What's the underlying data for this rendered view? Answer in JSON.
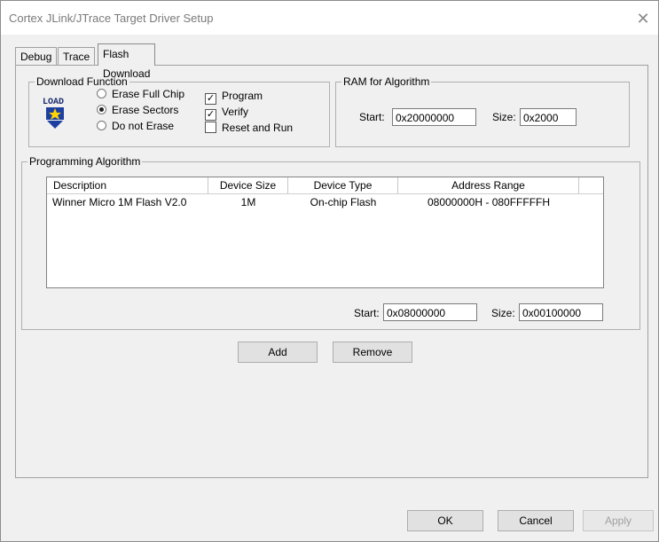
{
  "window": {
    "title": "Cortex JLink/JTrace Target Driver Setup",
    "close_glyph": "✕"
  },
  "tabs": [
    {
      "label": "Debug"
    },
    {
      "label": "Trace"
    },
    {
      "label": "Flash Download"
    }
  ],
  "download_function": {
    "label": "Download Function",
    "icon_text": "LOAD",
    "erase_full_chip": "Erase Full Chip",
    "erase_sectors": "Erase Sectors",
    "do_not_erase": "Do not Erase",
    "program": "Program",
    "verify": "Verify",
    "reset_and_run": "Reset and Run",
    "selected_erase": "Erase Sectors",
    "program_checked": true,
    "verify_checked": true,
    "reset_checked": false
  },
  "ram_for_algorithm": {
    "label": "RAM for Algorithm",
    "start_label": "Start:",
    "start_value": "0x20000000",
    "size_label": "Size:",
    "size_value": "0x2000"
  },
  "programming_algorithm": {
    "label": "Programming Algorithm",
    "columns": [
      "Description",
      "Device Size",
      "Device Type",
      "Address Range"
    ],
    "rows": [
      {
        "description": "Winner Micro 1M Flash V2.0",
        "device_size": "1M",
        "device_type": "On-chip Flash",
        "address_range": "08000000H - 080FFFFFH"
      }
    ],
    "start_label": "Start:",
    "start_value": "0x08000000",
    "size_label": "Size:",
    "size_value": "0x00100000"
  },
  "buttons": {
    "add": "Add",
    "remove": "Remove",
    "ok": "OK",
    "cancel": "Cancel",
    "apply": "Apply"
  },
  "check_glyph": "✓"
}
